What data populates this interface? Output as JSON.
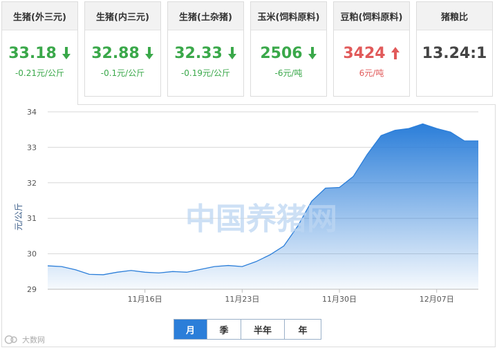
{
  "cards": [
    {
      "label": "生猪(外三元)",
      "value": "33.18",
      "change": "-0.21元/公斤",
      "trend": "down"
    },
    {
      "label": "生猪(内三元)",
      "value": "32.88",
      "change": "-0.1元/公斤",
      "trend": "down"
    },
    {
      "label": "生猪(土杂猪)",
      "value": "32.33",
      "change": "-0.19元/公斤",
      "trend": "down"
    },
    {
      "label": "玉米(饲料原料)",
      "value": "2506",
      "change": "-6元/吨",
      "trend": "down"
    },
    {
      "label": "豆粕(饲料原料)",
      "value": "3424",
      "change": "6元/吨",
      "trend": "up"
    },
    {
      "label": "猪粮比",
      "value": "13.24:1",
      "change": "",
      "trend": "none"
    }
  ],
  "colors": {
    "down": "#3aa84a",
    "up": "#e15a5a",
    "line": "#2b7ed9",
    "accent": "#2b7ed9"
  },
  "chart_data": {
    "type": "area",
    "title": "",
    "xlabel": "",
    "ylabel": "元/公斤",
    "ylim": [
      29,
      34
    ],
    "yticks": [
      "34",
      "33",
      "32",
      "31",
      "30",
      "29"
    ],
    "xticks": [
      "11月16日",
      "11月23日",
      "11月30日",
      "12月07日"
    ],
    "grid": true,
    "watermark": "中国养猪网",
    "x": [
      "11月09日",
      "11月10日",
      "11月11日",
      "11月12日",
      "11月13日",
      "11月14日",
      "11月15日",
      "11月16日",
      "11月17日",
      "11月18日",
      "11月19日",
      "11月20日",
      "11月21日",
      "11月22日",
      "11月23日",
      "11月24日",
      "11月25日",
      "11月26日",
      "11月27日",
      "11月28日",
      "11月29日",
      "11月30日",
      "12月01日",
      "12月02日",
      "12月03日",
      "12月04日",
      "12月05日",
      "12月06日",
      "12月07日",
      "12月08日",
      "12月09日",
      "12月10日"
    ],
    "series": [
      {
        "name": "",
        "values": [
          29.66,
          29.64,
          29.55,
          29.42,
          29.41,
          29.48,
          29.53,
          29.48,
          29.46,
          29.5,
          29.48,
          29.56,
          29.64,
          29.67,
          29.64,
          29.78,
          29.97,
          30.22,
          30.78,
          31.48,
          31.85,
          31.87,
          32.18,
          32.8,
          33.33,
          33.48,
          33.53,
          33.66,
          33.53,
          33.43,
          33.18,
          33.18
        ]
      }
    ]
  },
  "range": {
    "buttons": [
      "月",
      "季",
      "半年",
      "年"
    ],
    "selected": "月"
  },
  "credit": {
    "text": "大数网"
  }
}
